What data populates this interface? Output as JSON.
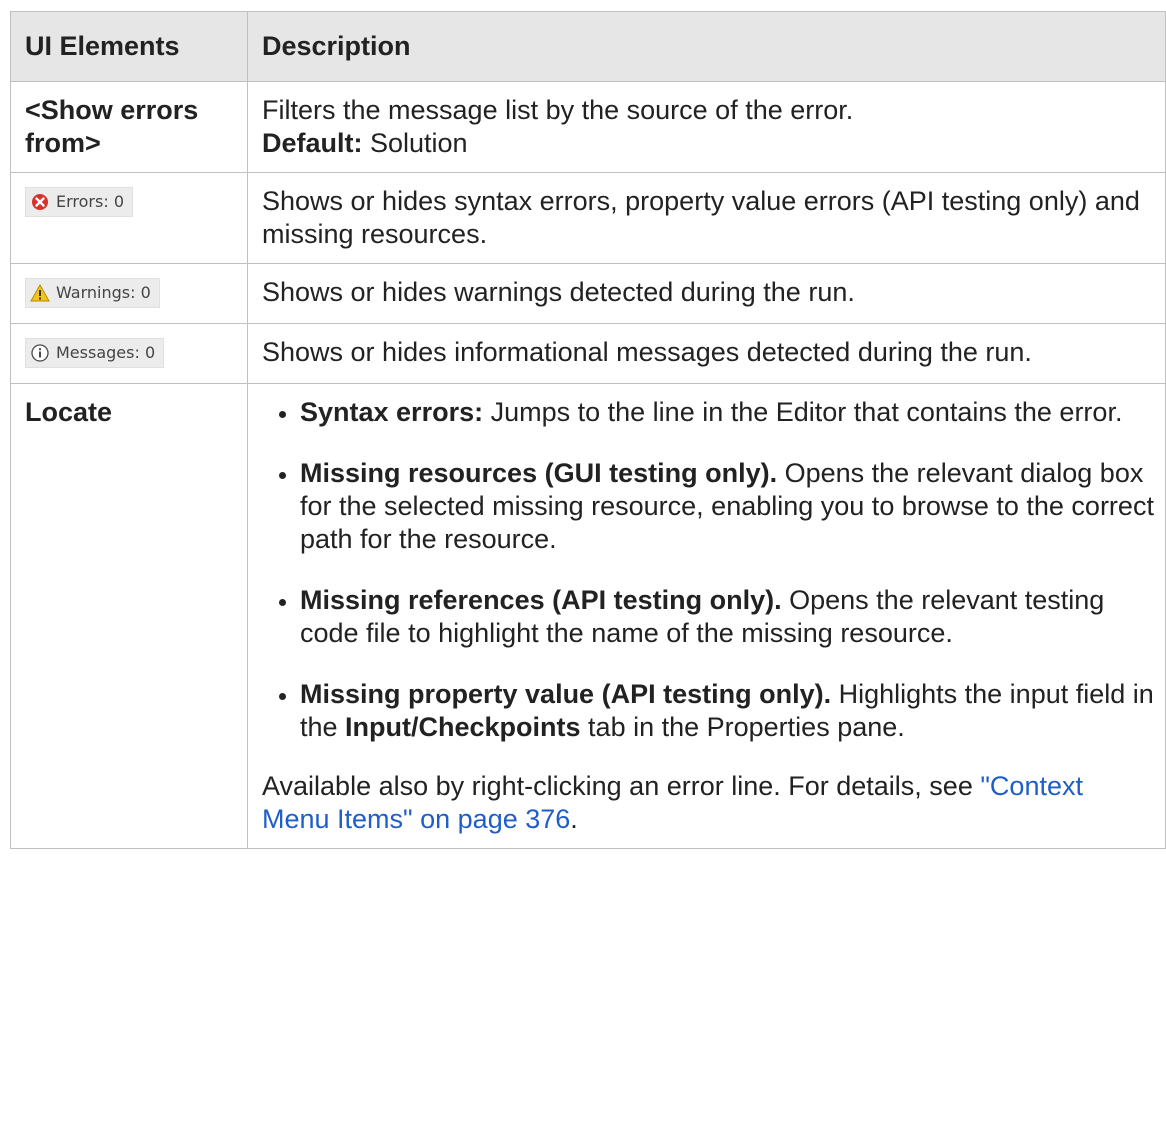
{
  "table": {
    "headers": [
      "UI Elements",
      "Description"
    ],
    "rows": {
      "show_errors": {
        "element": "<Show errors from>",
        "description": "Filters the message list by the source of the error.",
        "default_label": "Default:",
        "default_value": " Solution"
      },
      "errors": {
        "widget_label": "Errors: 0",
        "widget_icon": "error-icon",
        "description": "Shows or hides syntax errors, property value errors (API testing only) and missing resources."
      },
      "warnings": {
        "widget_label": "Warnings: 0",
        "widget_icon": "warning-icon",
        "description": "Shows or hides warnings detected during the run."
      },
      "messages": {
        "widget_label": "Messages: 0",
        "widget_icon": "info-icon",
        "description": "Shows or hides informational messages detected during the run."
      },
      "locate": {
        "element": "Locate",
        "bullets": [
          {
            "bold": "Syntax errors:",
            "text": " Jumps to the line in the Editor that contains the error."
          },
          {
            "bold": "Missing resources (GUI testing only).",
            "text": " Opens the relevant dialog box for the selected missing resource, enabling you to browse to the correct path for the resource."
          },
          {
            "bold": "Missing references (API testing only).",
            "text": " Opens the relevant testing code file to highlight the name of the missing resource."
          },
          {
            "bold": "Missing property value (API testing only).",
            "text_before": " Highlights the input field in the ",
            "bold2": "Input/Checkpoints",
            "text_after": " tab in the Properties pane."
          }
        ],
        "note": "Available also by right-clicking an error line. For details, see ",
        "link": "\"Context Menu Items\" on page 376",
        "note_end": "."
      }
    }
  },
  "colors": {
    "header_bg": "#e6e6e6",
    "border": "#c0c0c0",
    "link": "#1f5ec9",
    "error_icon": "#d9302a",
    "warning_icon": "#f3c419",
    "info_icon": "#4a4a4a"
  }
}
